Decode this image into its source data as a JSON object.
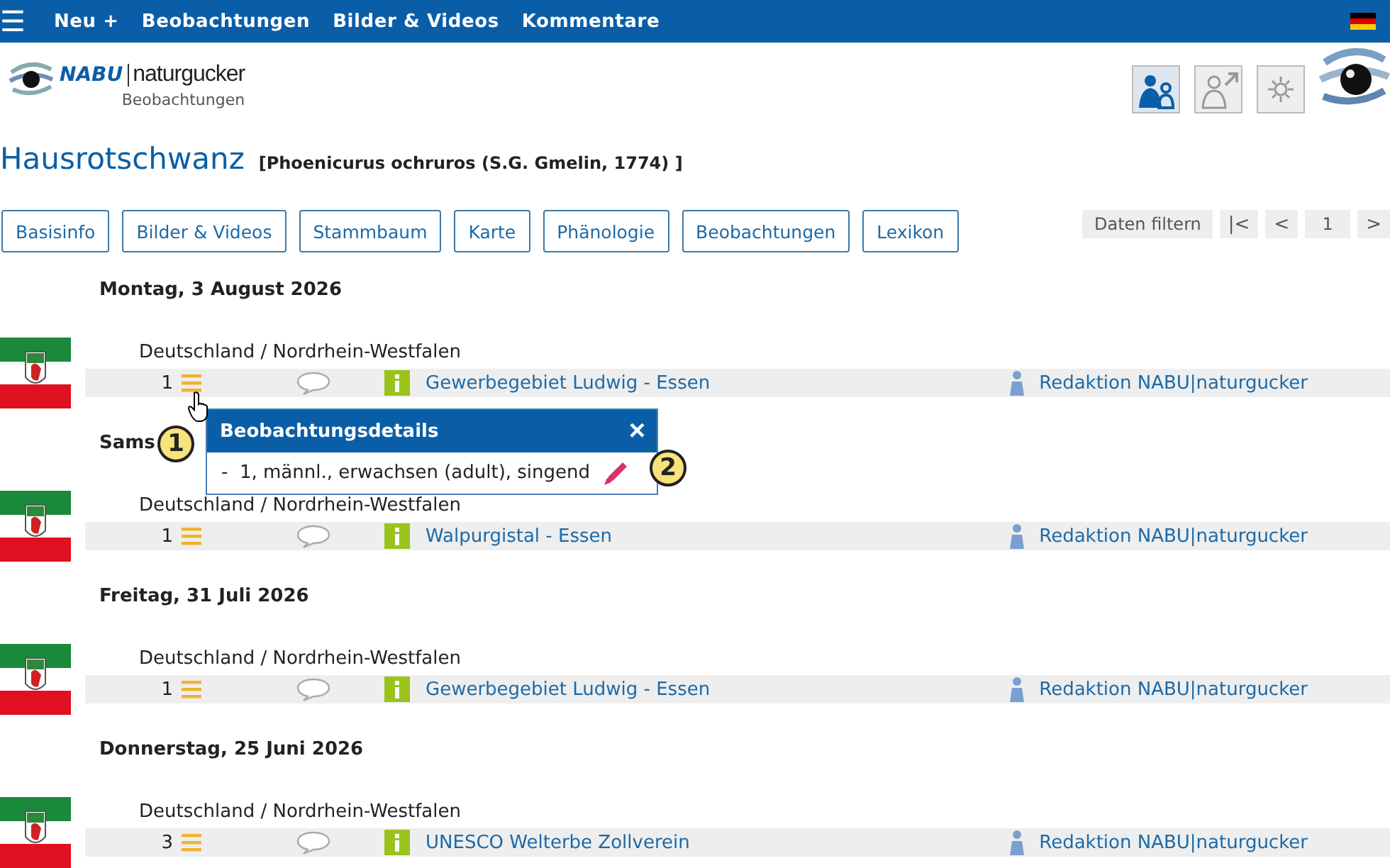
{
  "menu_bar": {
    "menu_icon": "☰",
    "items": [
      "Neu +",
      "Beobachtungen",
      "Bilder & Videos",
      "Kommentare"
    ]
  },
  "logo": {
    "brand": "NABU",
    "product": "naturgucker",
    "subtitle": "Beobachtungen"
  },
  "header_buttons": [
    {
      "kind": "family",
      "selected": true
    },
    {
      "kind": "person-arrow",
      "selected": false
    },
    {
      "kind": "sun",
      "selected": false
    }
  ],
  "species": {
    "name": "Hausrotschwanz",
    "scientific": "[Phoenicurus ochruros (S.G. Gmelin, 1774) ]"
  },
  "tabs": [
    "Basisinfo",
    "Bilder & Videos",
    "Stammbaum",
    "Karte",
    "Phänologie",
    "Beobachtungen",
    "Lexikon"
  ],
  "pager": {
    "filter": "Daten filtern",
    "first": "|<",
    "prev": "<",
    "page": "1",
    "next": ">"
  },
  "observations": [
    {
      "date": "Montag, 3 August 2026",
      "region": "Deutschland / Nordrhein-Westfalen",
      "count": "1",
      "site": "Gewerbegebiet Ludwig - Essen",
      "observer": "Redaktion NABU|naturgucker"
    },
    {
      "date": "Sams",
      "region": "Deutschland / Nordrhein-Westfalen",
      "count": "1",
      "site": "Walpurgistal - Essen",
      "observer": "Redaktion NABU|naturgucker"
    },
    {
      "date": "Freitag, 31 Juli 2026",
      "region": "Deutschland / Nordrhein-Westfalen",
      "count": "1",
      "site": "Gewerbegebiet Ludwig - Essen",
      "observer": "Redaktion NABU|naturgucker"
    },
    {
      "date": "Donnerstag, 25 Juni 2026",
      "region": "Deutschland / Nordrhein-Westfalen",
      "count": "3",
      "site": "UNESCO Welterbe Zollverein",
      "observer": "Redaktion NABU|naturgucker"
    }
  ],
  "popup": {
    "title": "Beobachtungsdetails",
    "close": "×",
    "detail": "-  1, männl., erwachsen (adult), singend"
  },
  "callouts": [
    "1",
    "2"
  ]
}
